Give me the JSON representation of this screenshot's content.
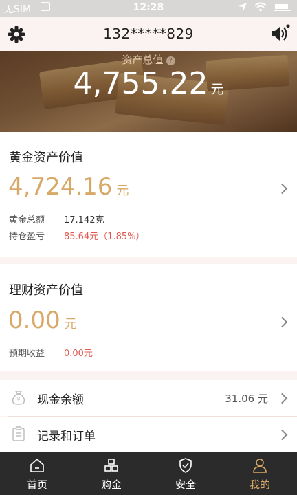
{
  "status_bar": {
    "carrier": "无SIM",
    "time": "12:28"
  },
  "header": {
    "phone": "132*****829"
  },
  "banner": {
    "label": "资产总值",
    "help": "?",
    "value": "4,755.22",
    "unit": "元"
  },
  "gold_card": {
    "title": "黄金资产价值",
    "value": "4,724.16",
    "unit": "元",
    "rows": [
      {
        "label": "黄金总额",
        "value": "17.142克"
      },
      {
        "label": "持仓盈亏",
        "value": "85.64元（1.85%）"
      }
    ]
  },
  "finance_card": {
    "title": "理财资产价值",
    "value": "0.00",
    "unit": "元",
    "rows": [
      {
        "label": "预期收益",
        "value": "0.00元"
      }
    ]
  },
  "list": [
    {
      "label": "现金余额",
      "value": "31.06 元",
      "icon": "money-bag-icon"
    },
    {
      "label": "记录和订单",
      "value": "",
      "icon": "clipboard-icon"
    }
  ],
  "tabs": [
    {
      "label": "首页",
      "icon": "home-icon",
      "active": false
    },
    {
      "label": "购金",
      "icon": "gold-bars-icon",
      "active": false
    },
    {
      "label": "安全",
      "icon": "shield-icon",
      "active": false
    },
    {
      "label": "我的",
      "icon": "person-icon",
      "active": true
    }
  ],
  "colors": {
    "accent": "#d8a867",
    "red": "#e05a52",
    "tabbar": "#2b2b2b",
    "background": "#fbf3f1"
  }
}
